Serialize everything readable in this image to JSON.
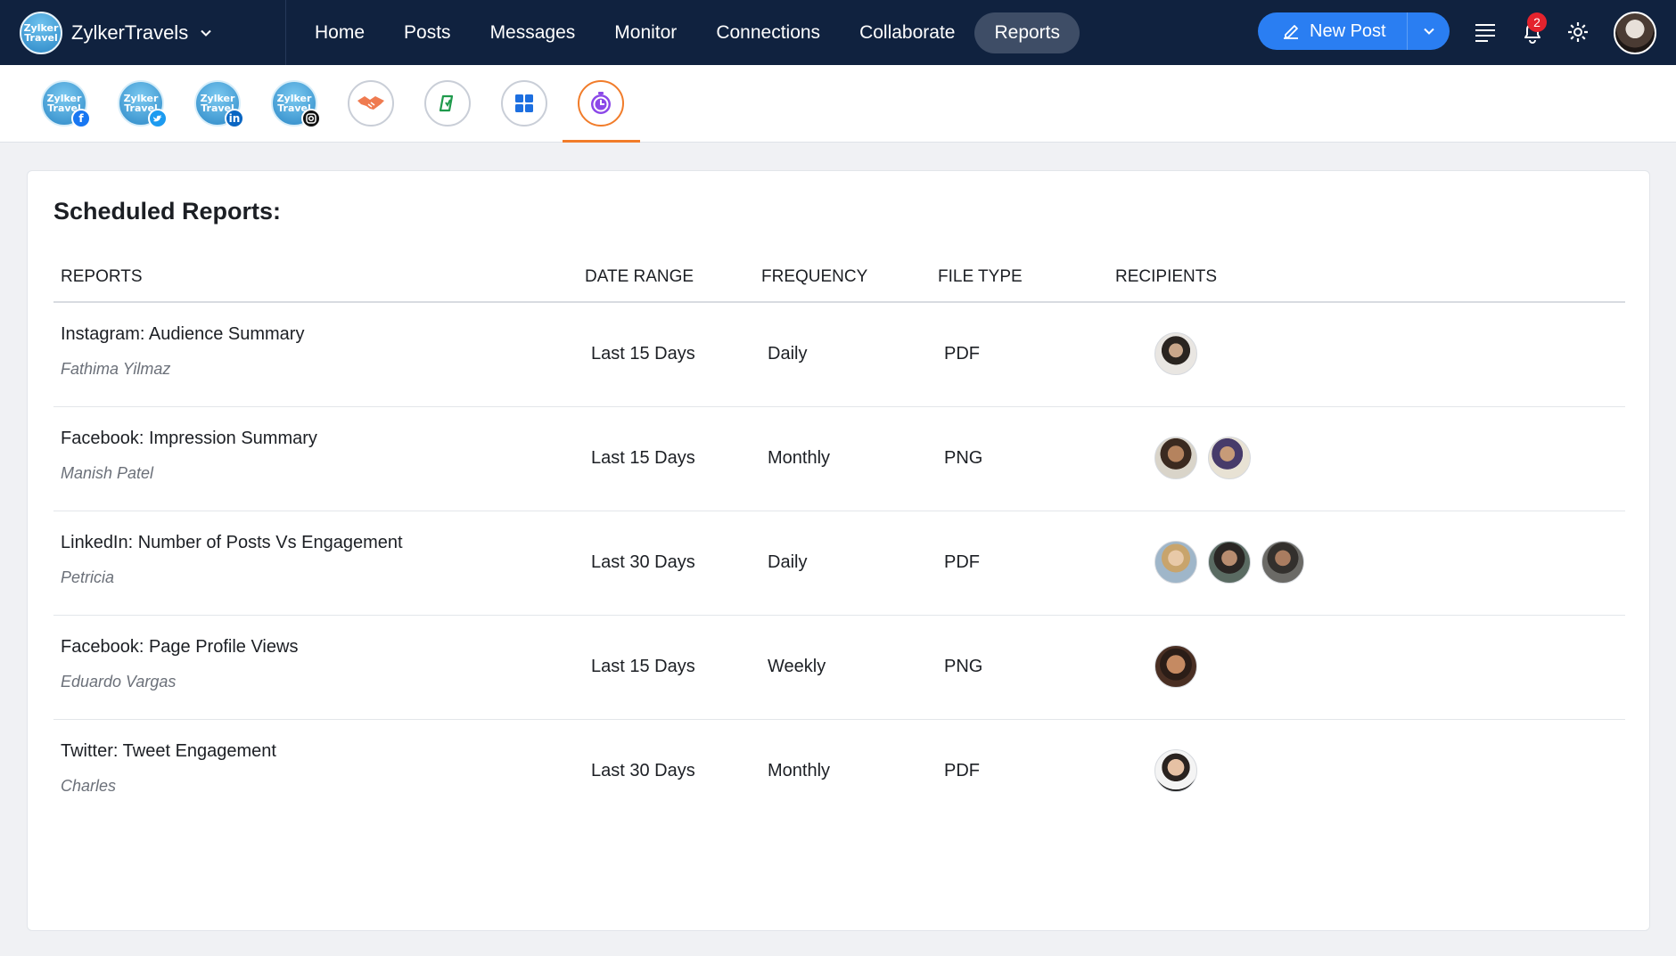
{
  "brand": {
    "initials_line1": "Zylker",
    "initials_line2": "Travel",
    "name": "ZylkerTravels"
  },
  "nav": {
    "items": [
      "Home",
      "Posts",
      "Messages",
      "Monitor",
      "Connections",
      "Collaborate",
      "Reports"
    ],
    "active": "Reports"
  },
  "actions": {
    "new_post_label": "New Post",
    "notification_count": "2"
  },
  "channels": [
    {
      "name": "ZylkerTravels Facebook",
      "network": "facebook"
    },
    {
      "name": "ZylkerTravels Twitter",
      "network": "twitter"
    },
    {
      "name": "ZylkerTravels LinkedIn",
      "network": "linkedin"
    },
    {
      "name": "ZylkerTravels Instagram",
      "network": "instagram"
    }
  ],
  "colors": {
    "topbar": "#10223f",
    "primary": "#2a7ef2",
    "accent": "#f17c2a",
    "badge": "#e4232d"
  },
  "page": {
    "title": "Scheduled Reports:",
    "columns": {
      "reports": "REPORTS",
      "date_range": "DATE RANGE",
      "frequency": "FREQUENCY",
      "file_type": "FILE TYPE",
      "recipients": "RECIPIENTS"
    },
    "rows": [
      {
        "title": "Instagram: Audience Summary",
        "owner": "Fathima Yilmaz",
        "date_range": "Last 15 Days",
        "frequency": "Daily",
        "file_type": "PDF",
        "recipients": 1
      },
      {
        "title": "Facebook: Impression Summary",
        "owner": "Manish Patel",
        "date_range": "Last 15 Days",
        "frequency": "Monthly",
        "file_type": "PNG",
        "recipients": 2
      },
      {
        "title": "LinkedIn: Number of Posts Vs Engagement",
        "owner": "Petricia",
        "date_range": "Last 30 Days",
        "frequency": "Daily",
        "file_type": "PDF",
        "recipients": 3
      },
      {
        "title": "Facebook: Page Profile Views",
        "owner": "Eduardo Vargas",
        "date_range": "Last 15 Days",
        "frequency": "Weekly",
        "file_type": "PNG",
        "recipients": 1
      },
      {
        "title": "Twitter: Tweet Engagement",
        "owner": "Charles",
        "date_range": "Last 30 Days",
        "frequency": "Monthly",
        "file_type": "PDF",
        "recipients": 1
      }
    ]
  }
}
